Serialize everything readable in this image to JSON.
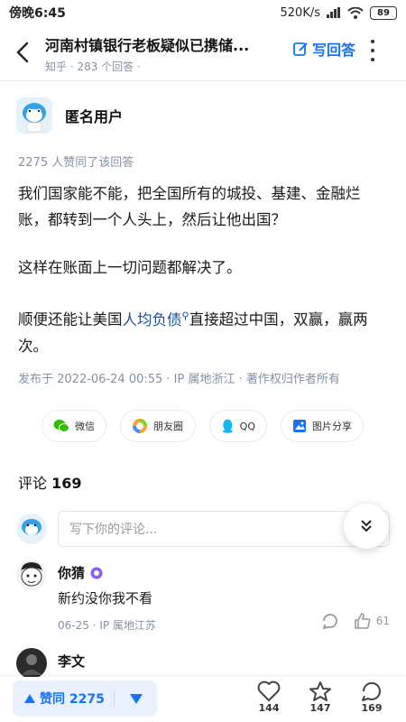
{
  "status_bar": {
    "time": "傍晚6:45",
    "speed": "520K/s",
    "battery": "89"
  },
  "header": {
    "title": "河南村镇银行老板疑似已携储...",
    "subtitle": "知乎 · 283 个回答 ·",
    "write_answer": "写回答"
  },
  "answer": {
    "author": "匿名用户",
    "votes_line": "2275 人赞同了该回答",
    "paragraphs": [
      "我们国家能不能，把全国所有的城投、基建、金融烂账，都转到一个人头上，然后让他出国？",
      "这样在账面上一切问题都解决了。"
    ],
    "p3_before": "顺便还能让美国",
    "p3_link": "人均负债",
    "p3_after": "直接超过中国，双赢，赢两次。",
    "meta": "发布于 2022-06-24 00:55 · IP 属地浙江 · 著作权归作者所有"
  },
  "share": [
    {
      "label": "微信",
      "icon": "wechat-icon",
      "color": "#2dc100"
    },
    {
      "label": "朋友圈",
      "icon": "moments-icon",
      "color": "#f6a623"
    },
    {
      "label": "QQ",
      "icon": "qq-icon",
      "color": "#12b7f5"
    },
    {
      "label": "图片分享",
      "icon": "image-share-icon",
      "color": "#1772f6"
    }
  ],
  "comments": {
    "label": "评论",
    "count": "169",
    "input_placeholder": "写下你的评论...",
    "items": [
      {
        "name": "你猜",
        "text": "新约没你我不看",
        "meta": "06-25 · IP 属地江苏",
        "likes": "61"
      },
      {
        "name": "李文"
      }
    ]
  },
  "bottom_bar": {
    "vote_label": "赞同 2275",
    "like_count": "144",
    "favorite_count": "147",
    "comment_count": "169"
  },
  "colors": {
    "accent": "#1772f6",
    "muted": "#8590a6",
    "link": "#175199"
  }
}
